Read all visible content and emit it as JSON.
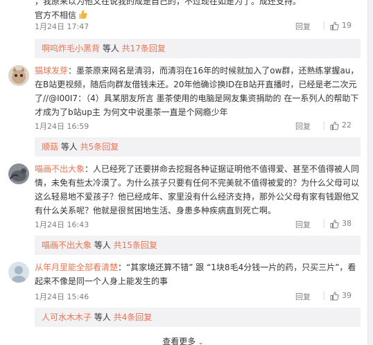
{
  "comments": [
    {
      "username": "",
      "text": "，我原来以为他又在说我的成是自己的，不过现在如是为了。成还支持。",
      "text2": "官方不相信",
      "date": "1月24日 17:47",
      "reply_label": "回复",
      "likes": "19"
    },
    {
      "username": "猫球发芽",
      "text": "：墨茶原来网名是清羽，而清羽在16年的时候就加入了ow群，还熟练掌握au，在B站更视频，随后向群友借钱未还。20年他确诊换ID在B站开直播时，已经是老二次元了//@I00I7：（4）具某朋友所言 墨茶使用的电脑是网友集资捐助的 在一系列人的帮助下才成为了b站up主 为何文中说墨茶一直是个网瘾少年",
      "date": "1月24日 16:59",
      "reply_label": "回复",
      "likes": "22"
    },
    {
      "username": "喵画不出大象",
      "text": "：人已经死了还要拼命去挖掘各种证据证明他不值得爱、甚至不值得被人同情，未免有些太冷漠了。为什么孩子只要有任何不完美就不值得被爱的？为什么父母可以这么轻易地不爱孩子？他已经成年、家里没有什么经济支持，那外公父母有家有钱跟他又有什么关系呢？他就是很贫困地生活、身患多种疾病直到死亡啊。",
      "date": "1月24日 16:43",
      "reply_label": "回复",
      "likes": "38"
    },
    {
      "username": "从年月里能全部看清楚",
      "text": "：“其家境还算不错” 跟 “1块8毛4分钱一片的药，只买三片”，看起来不像是同一个人身上能发生的事",
      "date": "1月24日 15:46",
      "reply_label": "回复",
      "likes": "39"
    }
  ],
  "subreplies": [
    {
      "user": "啊呜炸毛小黑背",
      "mid": " 等人 ",
      "count": "共17条回复"
    },
    {
      "user": "顺菇",
      "mid": " 等人 ",
      "count": "共5条回复"
    },
    {
      "user": "喵画不出大象",
      "mid": " 等人 ",
      "count": "共15条回复"
    },
    {
      "user": "人可水木木子",
      "mid": " 等人 ",
      "count": "共4条回复"
    }
  ],
  "more_label": "查看更多",
  "colors": {
    "username": "#eb7350",
    "meta": "#808080",
    "subbox_bg": "#f2f2f5"
  }
}
